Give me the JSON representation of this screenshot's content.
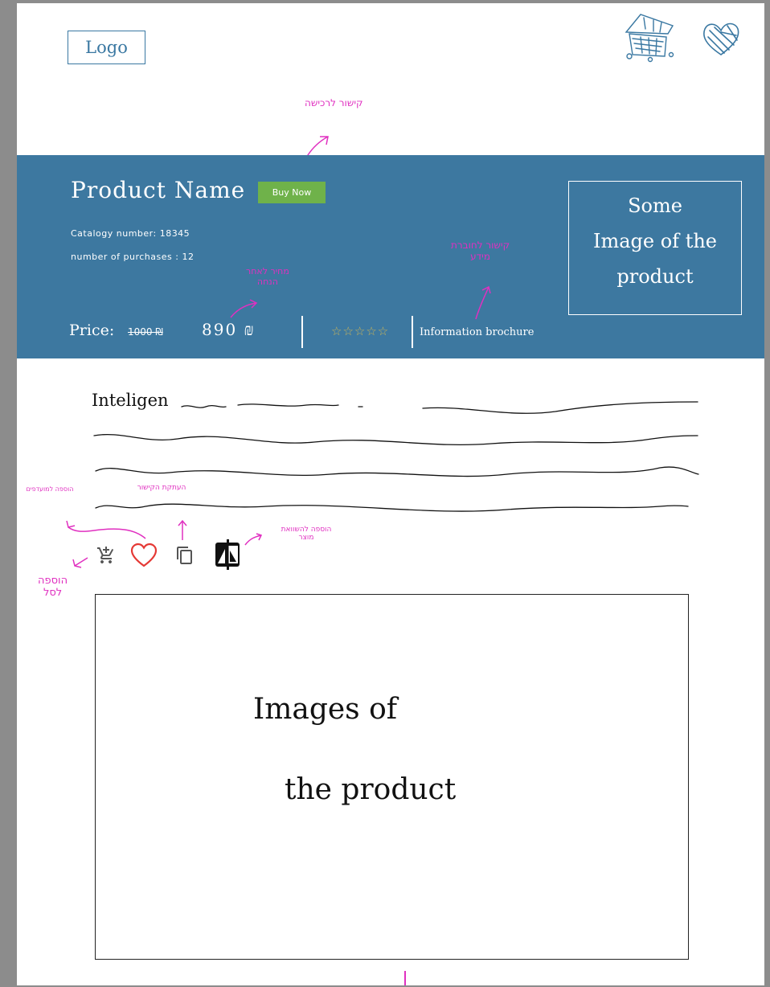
{
  "header": {
    "logo_text": "Logo",
    "icons": [
      "store-icon",
      "heart-icon"
    ]
  },
  "hero": {
    "product_name": "Product Name",
    "buy_label": "Buy Now",
    "catalog": "Catalogy number: 18345",
    "purchases": "number of purchases : 12",
    "price_label": "Price:",
    "old_price": "1000 ₪",
    "new_price": "890 ₪",
    "rating": "☆☆☆☆☆",
    "brochure_label": "Information brochure",
    "image_caption_lines": [
      "Some",
      "Image of the",
      "product"
    ],
    "colors": {
      "band": "#3d78a0",
      "buy": "#6fb24a",
      "stars": "#c8b45a"
    }
  },
  "description": {
    "first_word": "Inteligen"
  },
  "actions": {
    "icons": [
      "add-to-cart-icon",
      "favorite-heart-icon",
      "copy-icon",
      "compare-icon"
    ]
  },
  "gallery": {
    "caption_lines": [
      "Images of",
      "the product"
    ]
  },
  "annotations": {
    "buy_note": "קישור לרכישה",
    "price_note_1": "מחיר לאחר",
    "price_note_2": "הנחה",
    "brochure_note_1": "קישור לחוברת",
    "brochure_note_2": "מידע",
    "fav_note": "הוספה למועדפים",
    "copy_note": "העתקת הקישור",
    "compare_note": "הוספה להשוואת מוצר",
    "cart_note_1": "הוספה",
    "cart_note_2": "לסל"
  }
}
